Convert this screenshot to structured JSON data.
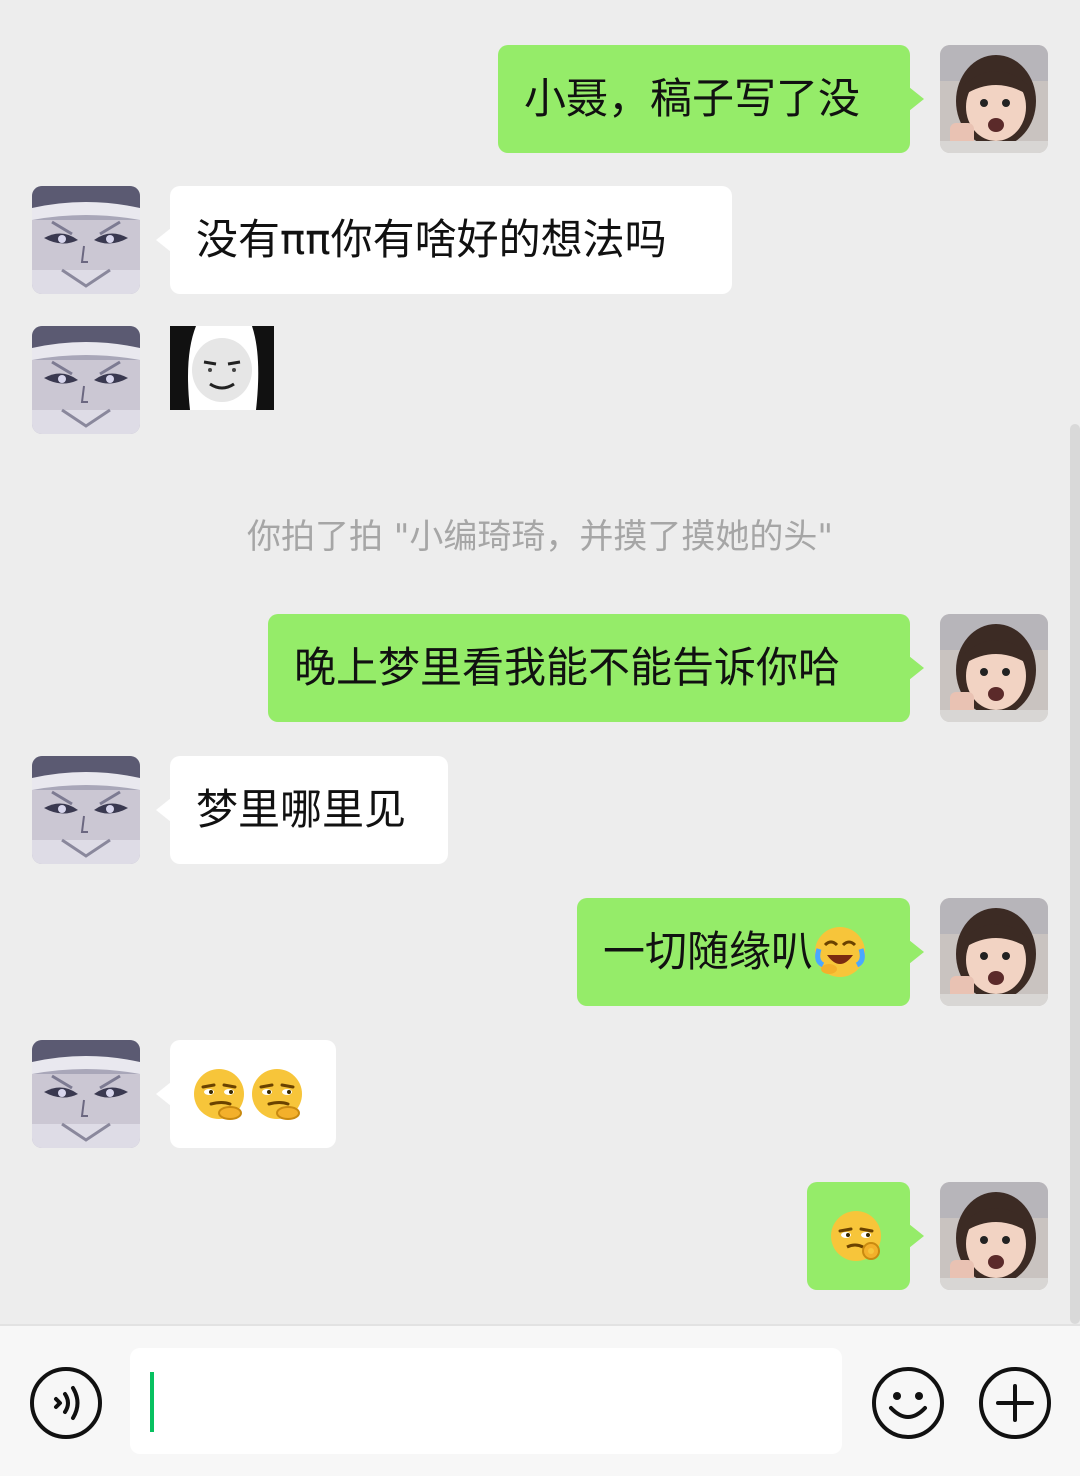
{
  "messages": [
    {
      "id": "m1",
      "side": "out",
      "text": "小聂，稿子写了没"
    },
    {
      "id": "m2",
      "side": "in",
      "text": "没有ππ你有啥好的想法吗"
    },
    {
      "id": "m3",
      "side": "in",
      "type": "sticker",
      "sticker": "panda-face-sticker"
    },
    {
      "id": "m4",
      "side": "system",
      "text": "你拍了拍 \"小编琦琦，并摸了摸她的头\""
    },
    {
      "id": "m5",
      "side": "out",
      "text": "晚上梦里看我能不能告诉你哈"
    },
    {
      "id": "m6",
      "side": "in",
      "text": "梦里哪里见"
    },
    {
      "id": "m7",
      "side": "out",
      "text": "一切随缘叭",
      "emoji": "laugh-cry-emoji"
    },
    {
      "id": "m8",
      "side": "in",
      "emojis": [
        "smirk-chin-emoji",
        "smirk-chin-emoji"
      ]
    },
    {
      "id": "m9",
      "side": "out",
      "emojis": [
        "smirk-ok-emoji"
      ]
    }
  ],
  "input": {
    "value": "",
    "placeholder": ""
  },
  "icons": {
    "voice": "voice-icon",
    "emoji": "emoji-icon",
    "more": "plus-icon"
  },
  "colors": {
    "outgoing_bubble": "#95ec69",
    "incoming_bubble": "#ffffff",
    "background": "#ededed",
    "caret": "#07c160",
    "system_text": "#a6a6a6"
  }
}
